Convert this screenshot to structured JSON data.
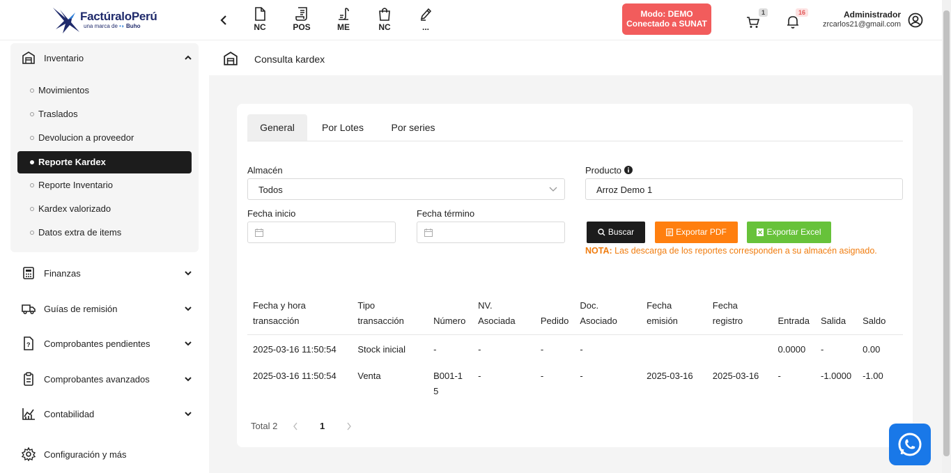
{
  "header": {
    "logo_text": "FactúraloPerú",
    "logo_sub_prefix": "una marca de",
    "logo_sub_brand": "Buho",
    "quick_actions": [
      {
        "label": "NC",
        "icon": "document-icon"
      },
      {
        "label": "POS",
        "icon": "receipt-icon"
      },
      {
        "label": "ME",
        "icon": "invoice-icon"
      },
      {
        "label": "NC",
        "icon": "shopping-bag-icon"
      },
      {
        "label": "...",
        "icon": "pencil-icon"
      }
    ],
    "demo_line1": "Modo: DEMO",
    "demo_line2": "Conectado a SUNAT",
    "cart_count": "1",
    "notif_count": "16",
    "user_name": "Administrador",
    "user_email": "zrcarlos21@gmail.com",
    "colors": {
      "demo": "#f25c5c",
      "brand": "#1f2a6b"
    }
  },
  "sidebar": {
    "inventario": "Inventario",
    "sub_items": [
      "Movimientos",
      "Traslados",
      "Devolucion a proveedor",
      "Reporte Kardex",
      "Reporte Inventario",
      "Kardex valorizado",
      "Datos extra de items"
    ],
    "active_sub": "Reporte Kardex",
    "items": [
      "Finanzas",
      "Guías de remisión",
      "Comprobantes pendientes",
      "Comprobantes avanzados",
      "Contabilidad",
      "Configuración y más"
    ]
  },
  "breadcrumb": {
    "title": "Consulta kardex"
  },
  "tabs": [
    "General",
    "Por Lotes",
    "Por series"
  ],
  "filters": {
    "almacen_label": "Almacén",
    "almacen_value": "Todos",
    "producto_label": "Producto",
    "producto_value": "Arroz Demo 1",
    "fecha_inicio_label": "Fecha inicio",
    "fecha_termino_label": "Fecha término"
  },
  "buttons": {
    "buscar": "Buscar",
    "pdf": "Exportar PDF",
    "excel": "Exportar Excel",
    "colors": {
      "buscar": "#1c1c1c",
      "pdf": "#ff7f0f",
      "excel": "#67c23a"
    }
  },
  "nota": {
    "prefix": "NOTA:",
    "text": " Las descarga de los reportes corresponden a su almacén asignado."
  },
  "table": {
    "headers": [
      [
        "Fecha y hora",
        "transacción"
      ],
      [
        "Tipo",
        "transacción"
      ],
      [
        "",
        "Número"
      ],
      [
        "NV.",
        "Asociada"
      ],
      [
        "",
        "Pedido"
      ],
      [
        "Doc.",
        "Asociado"
      ],
      [
        "Fecha",
        "emisión"
      ],
      [
        "Fecha",
        "registro"
      ],
      [
        "",
        "Entrada"
      ],
      [
        "",
        "Salida"
      ],
      [
        "",
        "Saldo"
      ]
    ],
    "rows": [
      [
        "2025-03-16 11:50:54",
        "Stock inicial",
        "-",
        "-",
        "-",
        "-",
        "",
        "",
        "0.0000",
        "-",
        "0.00"
      ],
      [
        "2025-03-16 11:50:54",
        "Venta",
        "B001-15",
        "-",
        "-",
        "-",
        "2025-03-16",
        "2025-03-16",
        "-",
        "-1.0000",
        "-1.00"
      ]
    ]
  },
  "pager": {
    "total": "Total 2",
    "current": "1"
  }
}
